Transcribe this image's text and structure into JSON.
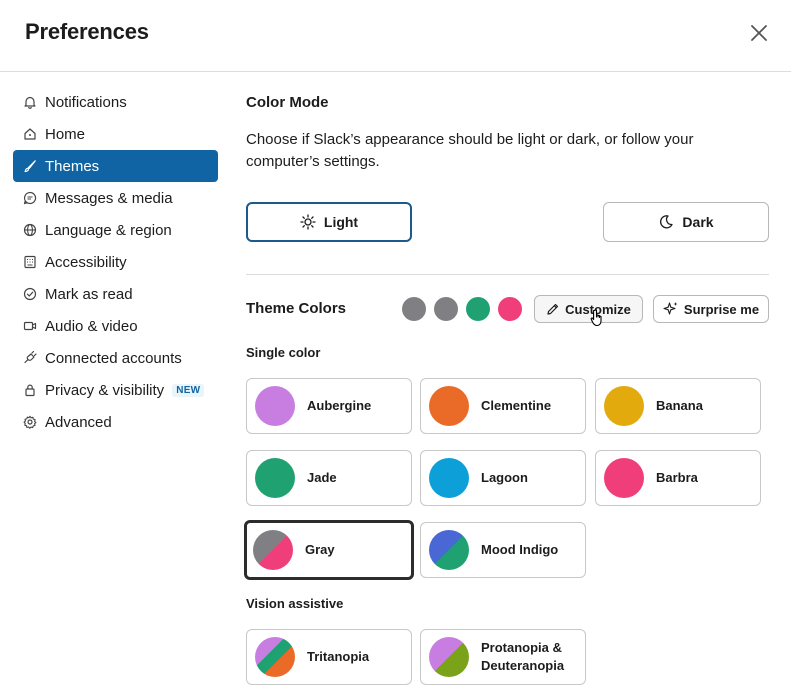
{
  "dialog": {
    "title": "Preferences"
  },
  "sidebar": {
    "items": [
      {
        "label": "Notifications",
        "icon": "bell-icon"
      },
      {
        "label": "Home",
        "icon": "home-icon"
      },
      {
        "label": "Themes",
        "icon": "brush-icon",
        "active": true
      },
      {
        "label": "Messages & media",
        "icon": "message-icon"
      },
      {
        "label": "Language & region",
        "icon": "globe-icon"
      },
      {
        "label": "Accessibility",
        "icon": "keyboard-icon"
      },
      {
        "label": "Mark as read",
        "icon": "check-circle-icon"
      },
      {
        "label": "Audio & video",
        "icon": "video-icon"
      },
      {
        "label": "Connected accounts",
        "icon": "plug-icon"
      },
      {
        "label": "Privacy & visibility",
        "icon": "lock-icon",
        "badge": "NEW"
      },
      {
        "label": "Advanced",
        "icon": "gear-icon"
      }
    ]
  },
  "color_mode": {
    "heading": "Color Mode",
    "description": "Choose if Slack’s appearance should be light or dark, or follow your computer’s settings.",
    "light_label": "Light",
    "dark_label": "Dark",
    "selected": "Light"
  },
  "theme_colors": {
    "heading": "Theme Colors",
    "preview_colors": [
      "#808084",
      "#808084",
      "#1fa172",
      "#ef3e7a"
    ],
    "customize_label": "Customize",
    "surprise_label": "Surprise me"
  },
  "single_color": {
    "heading": "Single color",
    "themes": [
      {
        "name": "Aubergine",
        "colors": [
          "#c77ee0"
        ]
      },
      {
        "name": "Clementine",
        "colors": [
          "#ea6a28"
        ]
      },
      {
        "name": "Banana",
        "colors": [
          "#e2aa0c"
        ]
      },
      {
        "name": "Jade",
        "colors": [
          "#1fa172"
        ]
      },
      {
        "name": "Lagoon",
        "colors": [
          "#0c9fd8"
        ]
      },
      {
        "name": "Barbra",
        "colors": [
          "#ef3e7a"
        ]
      },
      {
        "name": "Gray",
        "colors": [
          "#808084",
          "#ef3e7a"
        ],
        "selected": true
      },
      {
        "name": "Mood Indigo",
        "colors": [
          "#4a67d6",
          "#1fa172"
        ]
      }
    ]
  },
  "vision_assistive": {
    "heading": "Vision assistive",
    "themes": [
      {
        "name": "Tritanopia",
        "colors": [
          "#c77ee0",
          "#1fa172",
          "#ea6a28"
        ]
      },
      {
        "name_line1": "Protanopia &",
        "name_line2": "Deuteranopia",
        "colors": [
          "#c77ee0",
          "#7ba31a"
        ]
      }
    ]
  }
}
